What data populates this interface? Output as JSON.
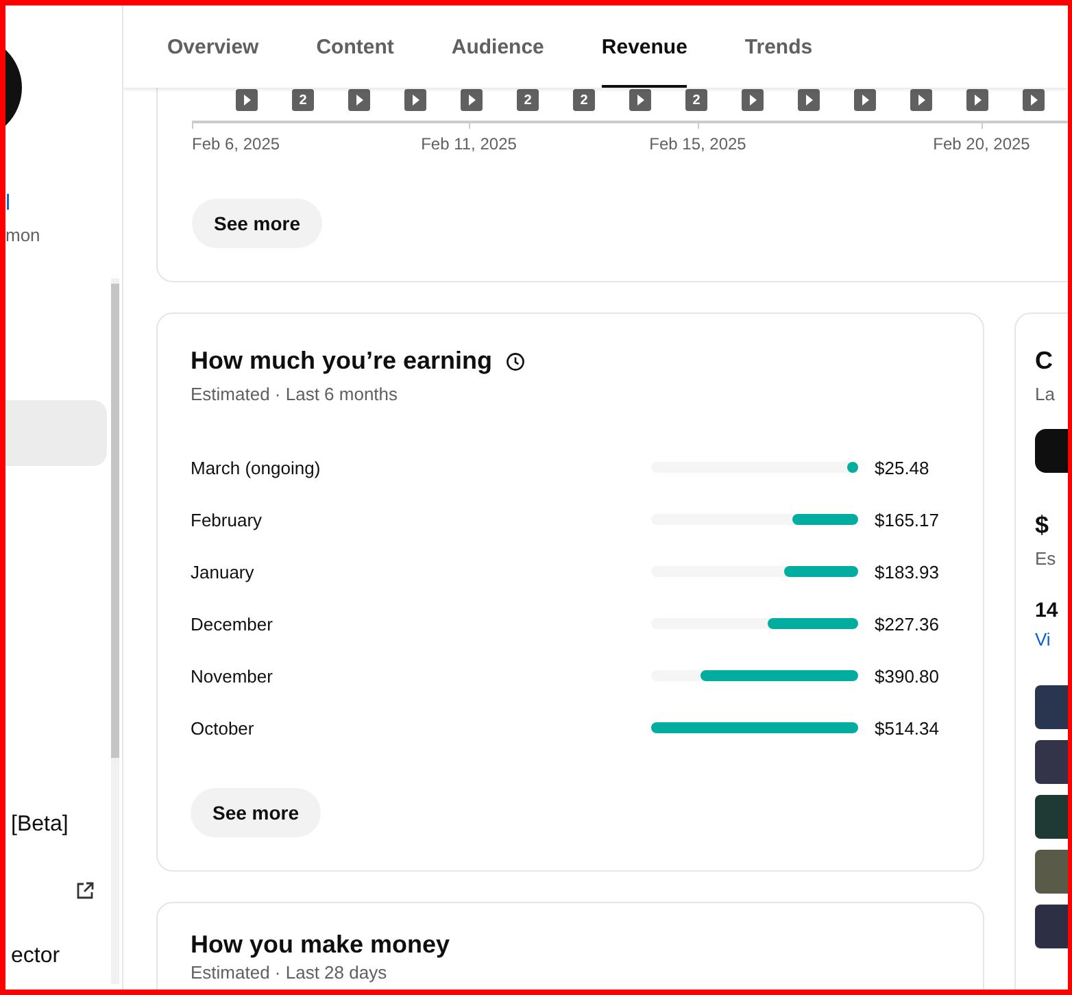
{
  "sidebar": {
    "channel_name": "l",
    "channel_subtitle": "mon",
    "nav_items": [
      {
        "selected": true
      },
      {
        "label": "[Beta]",
        "selected": false
      },
      {
        "external": true,
        "selected": false
      },
      {
        "label": "ector",
        "selected": false
      }
    ]
  },
  "tabs": [
    {
      "label": "Overview",
      "selected": false
    },
    {
      "label": "Content",
      "selected": false
    },
    {
      "label": "Audience",
      "selected": false
    },
    {
      "label": "Revenue",
      "selected": true
    },
    {
      "label": "Trends",
      "selected": false
    }
  ],
  "timeline": {
    "markers": [
      {
        "kind": "video"
      },
      {
        "kind": "count",
        "count": "2"
      },
      {
        "kind": "video"
      },
      {
        "kind": "video"
      },
      {
        "kind": "video"
      },
      {
        "kind": "count",
        "count": "2"
      },
      {
        "kind": "count",
        "count": "2"
      },
      {
        "kind": "video"
      },
      {
        "kind": "count",
        "count": "2"
      },
      {
        "kind": "video"
      },
      {
        "kind": "video"
      },
      {
        "kind": "video"
      },
      {
        "kind": "video"
      },
      {
        "kind": "video"
      },
      {
        "kind": "video"
      }
    ],
    "dates": [
      "Feb 6, 2025",
      "Feb 11, 2025",
      "Feb 15, 2025",
      "Feb 20, 2025"
    ],
    "button": "See more"
  },
  "earnings": {
    "title": "How much you’re earning",
    "subtitle": "Estimated · Last 6 months",
    "rows": [
      {
        "month": "March (ongoing)",
        "level": 0.05,
        "amount": "$25.48"
      },
      {
        "month": "February",
        "level": 0.32,
        "amount": "$165.17"
      },
      {
        "month": "January",
        "level": 0.36,
        "amount": "$183.93"
      },
      {
        "month": "December",
        "level": 0.44,
        "amount": "$227.36"
      },
      {
        "month": "November",
        "level": 0.76,
        "amount": "$390.80"
      },
      {
        "month": "October",
        "level": 1,
        "amount": "$514.34"
      }
    ],
    "button": "See more"
  },
  "side_card": {
    "title": "C",
    "subtitle": "La",
    "value": "$",
    "value_caption": "Es",
    "views": "14",
    "views_caption": "Vi"
  },
  "money": {
    "title": "How you make money",
    "subtitle": "Estimated · Last 28 days"
  }
}
